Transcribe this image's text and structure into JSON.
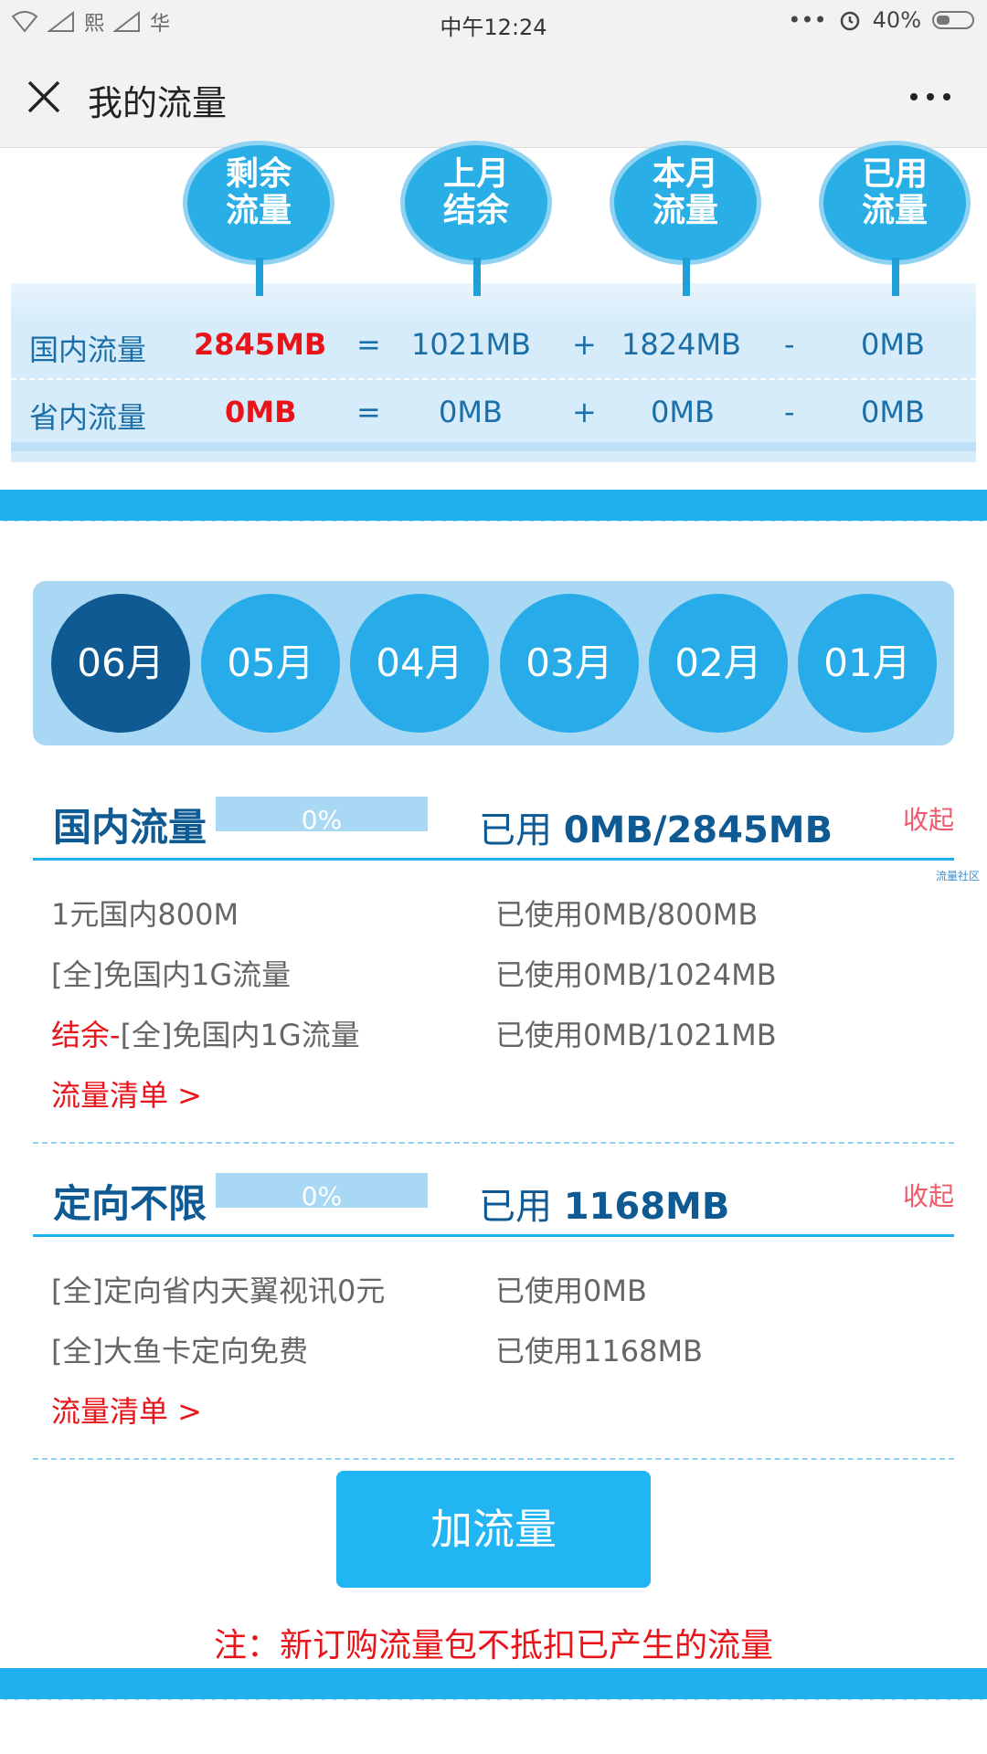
{
  "status_bar": {
    "carrier1": "熙",
    "carrier2": "华",
    "time": "中午12:24",
    "dots": "•••",
    "battery": "40%"
  },
  "header": {
    "title": "我的流量"
  },
  "summary": {
    "headers": [
      "剩余\n流量",
      "上月\n结余",
      "本月\n流量",
      "已用\n流量"
    ],
    "rows": [
      {
        "label": "国内流量",
        "remaining": "2845MB",
        "eq": "=",
        "last_month": "1021MB",
        "plus": "+",
        "this_month": "1824MB",
        "minus": "-",
        "used": "0MB"
      },
      {
        "label": "省内流量",
        "remaining": "0MB",
        "eq": "=",
        "last_month": "0MB",
        "plus": "+",
        "this_month": "0MB",
        "minus": "-",
        "used": "0MB"
      }
    ]
  },
  "months": [
    "06月",
    "05月",
    "04月",
    "03月",
    "02月",
    "01月"
  ],
  "sections": [
    {
      "title": "国内流量",
      "progress": "0%",
      "used_prefix": "已用",
      "used_value": "0MB/2845MB",
      "collapse": "收起",
      "items": [
        {
          "name": "1元国内800M",
          "usage": "已使用0MB/800MB"
        },
        {
          "name": "[全]免国内1G流量",
          "usage": "已使用0MB/1024MB"
        },
        {
          "prefix": "结余-",
          "name": "[全]免国内1G流量",
          "usage": "已使用0MB/1021MB"
        }
      ],
      "link": "流量清单 >"
    },
    {
      "title": "定向不限",
      "progress": "0%",
      "used_prefix": "已用",
      "used_value": "1168MB",
      "collapse": "收起",
      "items": [
        {
          "name": "[全]定向省内天翼视讯0元",
          "usage": "已使用0MB"
        },
        {
          "name": "[全]大鱼卡定向免费",
          "usage": "已使用1168MB"
        }
      ],
      "link": "流量清单 >"
    }
  ],
  "community": "流量社区",
  "add_button": "加流量",
  "note": "注：新订购流量包不抵扣已产生的流量",
  "colors": {
    "accent": "#1fb1ee",
    "dark_blue": "#0f5a93",
    "red": "#e8141a",
    "pale_blue": "#d7ecfa"
  }
}
